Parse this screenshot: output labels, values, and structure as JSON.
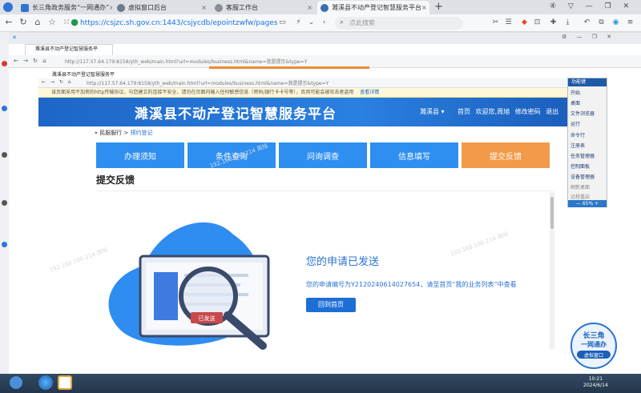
{
  "browser": {
    "tabs": [
      {
        "label": "长三角政务服务“一网通办”",
        "color": "#2f73d6"
      },
      {
        "label": "虚拟窗口后台",
        "color": "#6c7a8a"
      },
      {
        "label": "客服工作台",
        "color": "#8a8f96"
      },
      {
        "label": "濉溪县不动产登记智慧服务平台",
        "color": "#3a6fb0"
      }
    ],
    "new_tab": "+",
    "url": "https://csjzc.sh.gov.cn:1443/csjycdb/epointzwfw/pages",
    "search_placeholder": "点此搜索"
  },
  "remote1": {
    "tab_label": "濉溪县不动产登记智慧服务平",
    "url": "http://117.57.64.179:8158/yth_web/main.html?url=modules/business.html&name=我是提示&type=Y"
  },
  "remote2": {
    "tab_label": "濉溪县不动产登记智慧服务平",
    "url": "http://117.57.64.179:8158/yth_web/main.html?url=modules/business.html&name=我是提示&type=Y",
    "notice": "该页面采用不加密的http传输协议，与您建立的连接不安全，请勿在页面内输入任何敏感信息（密码/银行卡卡号等），否则可能会被攻击者盗用",
    "notice_link": "查看详情"
  },
  "site": {
    "title": "濉溪县不动产登记智慧服务平台",
    "region": "濉溪县 ▾",
    "nav": [
      "首页",
      "欢迎您,周旭",
      "修改密码",
      "退出"
    ],
    "breadcrumb": {
      "home": "民服服行",
      "current": "预约登记"
    },
    "steps": [
      "办理须知",
      "条件查询",
      "问询调查",
      "信息填写",
      "提交反馈"
    ],
    "active_step": 4,
    "section_title": "提交反馈",
    "success_title": "您的申请已发送",
    "success_text": "您的申请编号为Y2120240614027654，请至首页“我的业务列表”中查看",
    "back_button": "回到首页",
    "illustration_label": "已发送"
  },
  "context_menu": {
    "header": "功能键",
    "items": [
      "开始",
      "桌面",
      "文件浏览器",
      "运行",
      "命令行",
      "注册表",
      "任务管理器",
      "控制面板",
      "设备管理器",
      "刷新桌面",
      "远程重启"
    ],
    "zoom": "65%"
  },
  "taskbar": {
    "time": "10:21",
    "date": "2024/6/14"
  },
  "badge": {
    "line1": "长三角",
    "line2": "一网通办",
    "line3": "虚拟窗口"
  },
  "watermark": "192.168.100.214 周旭"
}
